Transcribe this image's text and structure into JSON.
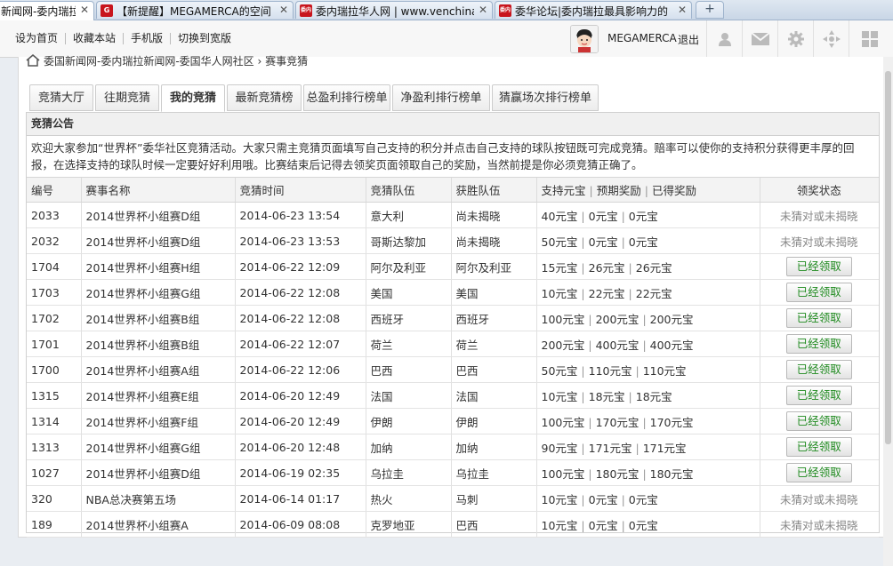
{
  "browser": {
    "tabs": [
      {
        "title": "新闻网-委内瑞拉",
        "favicon": ""
      },
      {
        "title": "【新提醒】MEGAMERCA的空间",
        "favicon": "G"
      },
      {
        "title": "委内瑞拉华人网 | www.venchina",
        "favicon": "委内"
      },
      {
        "title": "委华论坛|委内瑞拉最具影响力的",
        "favicon": "委内"
      }
    ],
    "new_tab_label": "+"
  },
  "topbar": {
    "links": [
      "设为首页",
      "收藏本站",
      "手机版",
      "切换到宽版"
    ],
    "username": "MEGAMERCA",
    "logout": "退出"
  },
  "breadcrumb": "委国新闻网-委内瑞拉新闻网-委国华人网社区 › 赛事竞猜",
  "tabs": [
    "竞猜大厅",
    "往期竞猜",
    "我的竞猜",
    "最新竞猜榜",
    "总盈利排行榜单",
    "净盈利排行榜单",
    "猜赢场次排行榜单"
  ],
  "active_tab": 2,
  "notice": {
    "title": "竞猜公告",
    "body": "欢迎大家参加“世界杯”委华社区竞猜活动。大家只需主竞猜页面填写自己支持的积分并点击自己支持的球队按钮既可完成竞猜。赔率可以使你的支持积分获得更丰厚的回报，在选择支持的球队时候一定要好好利用哦。比赛结束后记得去领奖页面领取自己的奖励，当然前提是你必须竞猜正确了。"
  },
  "table": {
    "headers": {
      "id": "编号",
      "match": "赛事名称",
      "time": "竞猜时间",
      "team": "竞猜队伍",
      "winner": "获胜队伍",
      "support": "支持元宝",
      "expected": "预期奖励",
      "got": "已得奖励",
      "status": "领奖状态"
    },
    "rows": [
      {
        "id": "2033",
        "match": "2014世界杯小组赛D组",
        "time": "2014-06-23 13:54",
        "team": "意大利",
        "winner": "尚未揭晓",
        "support": "40元宝",
        "expected": "0元宝",
        "got": "0元宝",
        "status": "未猜对或未揭晓",
        "claimed": false
      },
      {
        "id": "2032",
        "match": "2014世界杯小组赛D组",
        "time": "2014-06-23 13:53",
        "team": "哥斯达黎加",
        "winner": "尚未揭晓",
        "support": "50元宝",
        "expected": "0元宝",
        "got": "0元宝",
        "status": "未猜对或未揭晓",
        "claimed": false
      },
      {
        "id": "1704",
        "match": "2014世界杯小组赛H组",
        "time": "2014-06-22 12:09",
        "team": "阿尔及利亚",
        "winner": "阿尔及利亚",
        "support": "15元宝",
        "expected": "26元宝",
        "got": "26元宝",
        "status": "已经领取",
        "claimed": true
      },
      {
        "id": "1703",
        "match": "2014世界杯小组赛G组",
        "time": "2014-06-22 12:08",
        "team": "美国",
        "winner": "美国",
        "support": "10元宝",
        "expected": "22元宝",
        "got": "22元宝",
        "status": "已经领取",
        "claimed": true
      },
      {
        "id": "1702",
        "match": "2014世界杯小组赛B组",
        "time": "2014-06-22 12:08",
        "team": "西班牙",
        "winner": "西班牙",
        "support": "100元宝",
        "expected": "200元宝",
        "got": "200元宝",
        "status": "已经领取",
        "claimed": true
      },
      {
        "id": "1701",
        "match": "2014世界杯小组赛B组",
        "time": "2014-06-22 12:07",
        "team": "荷兰",
        "winner": "荷兰",
        "support": "200元宝",
        "expected": "400元宝",
        "got": "400元宝",
        "status": "已经领取",
        "claimed": true
      },
      {
        "id": "1700",
        "match": "2014世界杯小组赛A组",
        "time": "2014-06-22 12:06",
        "team": "巴西",
        "winner": "巴西",
        "support": "50元宝",
        "expected": "110元宝",
        "got": "110元宝",
        "status": "已经领取",
        "claimed": true
      },
      {
        "id": "1315",
        "match": "2014世界杯小组赛E组",
        "time": "2014-06-20 12:49",
        "team": "法国",
        "winner": "法国",
        "support": "10元宝",
        "expected": "18元宝",
        "got": "18元宝",
        "status": "已经领取",
        "claimed": true
      },
      {
        "id": "1314",
        "match": "2014世界杯小组赛F组",
        "time": "2014-06-20 12:49",
        "team": "伊朗",
        "winner": "伊朗",
        "support": "100元宝",
        "expected": "170元宝",
        "got": "170元宝",
        "status": "已经领取",
        "claimed": true
      },
      {
        "id": "1313",
        "match": "2014世界杯小组赛G组",
        "time": "2014-06-20 12:48",
        "team": "加纳",
        "winner": "加纳",
        "support": "90元宝",
        "expected": "171元宝",
        "got": "171元宝",
        "status": "已经领取",
        "claimed": true
      },
      {
        "id": "1027",
        "match": "2014世界杯小组赛D组",
        "time": "2014-06-19 02:35",
        "team": "乌拉圭",
        "winner": "乌拉圭",
        "support": "100元宝",
        "expected": "180元宝",
        "got": "180元宝",
        "status": "已经领取",
        "claimed": true
      },
      {
        "id": "320",
        "match": "NBA总决赛第五场",
        "time": "2014-06-14 01:17",
        "team": "热火",
        "winner": "马刺",
        "support": "10元宝",
        "expected": "0元宝",
        "got": "0元宝",
        "status": "未猜对或未揭晓",
        "claimed": false
      },
      {
        "id": "189",
        "match": "2014世界杯小组赛A",
        "time": "2014-06-09 08:08",
        "team": "克罗地亚",
        "winner": "巴西",
        "support": "10元宝",
        "expected": "0元宝",
        "got": "0元宝",
        "status": "未猜对或未揭晓",
        "claimed": false
      }
    ]
  },
  "icons": [
    "home-icon",
    "user-icon",
    "mail-icon",
    "gear-icon",
    "navigate-icon",
    "grid-icon"
  ],
  "colors": {
    "claimed_text": "#1f8a1f",
    "unclaimed_text": "#888888",
    "favicon_red": "#c8151d"
  }
}
